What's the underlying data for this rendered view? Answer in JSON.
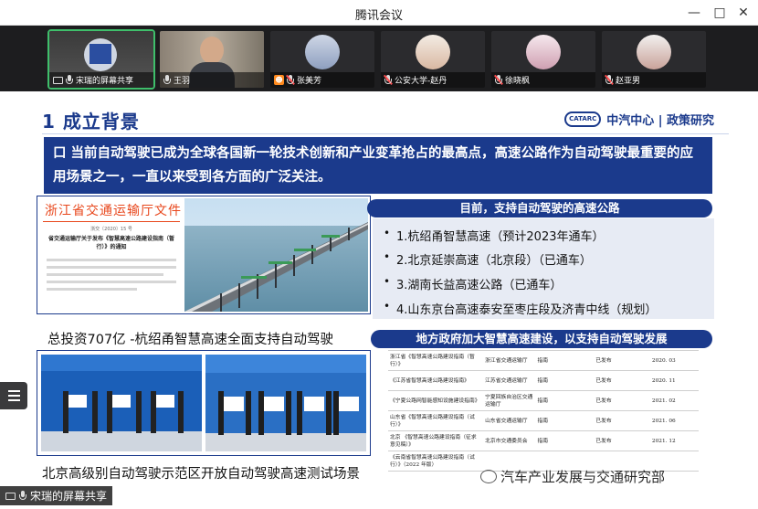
{
  "window": {
    "title": "腾讯会议",
    "controls": [
      "minimize",
      "maximize",
      "close"
    ]
  },
  "participants": [
    {
      "name": "宋瑞的屏幕共享",
      "icon": "screen-share-icon",
      "mic": "on",
      "active": true
    },
    {
      "name": "王羽",
      "icon": "mic-icon",
      "mic": "on",
      "active": false
    },
    {
      "name": "张美芳",
      "icon": "host-icon",
      "mic": "muted",
      "active": false
    },
    {
      "name": "公安大学-赵丹",
      "icon": "mic-muted-icon",
      "mic": "muted",
      "active": false
    },
    {
      "name": "徐晓枫",
      "icon": "mic-muted-icon",
      "mic": "muted",
      "active": false
    },
    {
      "name": "赵亚男",
      "icon": "mic-muted-icon",
      "mic": "muted",
      "active": false
    }
  ],
  "slide": {
    "title": "1  成立背景",
    "logo_mark": "CATARC",
    "logo_brand": "中汽中心 | 政策研究",
    "banner": "口 当前自动驾驶已成为全球各国新一轮技术创新和产业变革抢占的最高点，高速公路作为自动驾驶最重要的应用场景之一，一直以来受到各方面的广泛关注。",
    "doc": {
      "header": "浙江省交通运输厅文件",
      "number": "浙交〔2020〕15 号",
      "subject": "省交通运输厅关于发布《智慧高速公路建设指南（暂行）》的通知"
    },
    "caption_investment": "总投资707亿 -杭绍甬智慧高速全面支持自动驾驶",
    "caption_beijing": "北京高级别自动驾驶示范区开放自动驾驶高速测试场景",
    "highways_title": "目前，支持自动驾驶的高速公路",
    "highways": [
      "1.杭绍甬智慧高速（预计2023年通车）",
      "2.北京延崇高速（北京段）（已通车）",
      "3.湖南长益高速公路（已通车）",
      "4.山东京台高速泰安至枣庄段及济青中线（规划）"
    ],
    "policies_title": "地方政府加大智慧高速建设，以支持自动驾驶发展",
    "policies": [
      {
        "region": "浙江省",
        "doc": "《智慧高速公路建设指南（暂行）》",
        "org": "浙江省交通运输厅",
        "type": "指南",
        "status": "已发布",
        "date": "2020. 03"
      },
      {
        "region": "",
        "doc": "《江苏省智慧高速公路建设指南》",
        "org": "江苏省交通运输厅",
        "type": "指南",
        "status": "已发布",
        "date": "2020. 11"
      },
      {
        "region": "",
        "doc": "《宁夏公路网智能感知设施建设指南》",
        "org": "宁夏回族自治区交通运输厅",
        "type": "指南",
        "status": "已发布",
        "date": "2021. 02"
      },
      {
        "region": "山东省",
        "doc": "《智慧高速公路建设指南（试行）》",
        "org": "山东省交通运输厅",
        "type": "指南",
        "status": "已发布",
        "date": "2021. 06"
      },
      {
        "region": "北京",
        "doc": "《智慧高速公路建设指南（征求意见稿）》",
        "org": "北京市交通委员会",
        "type": "指南",
        "status": "已发布",
        "date": "2021. 12"
      },
      {
        "region": "",
        "doc": "《云南省智慧高速公路建设指南（试行）》（2022 年版）",
        "org": "",
        "type": "",
        "status": "",
        "date": ""
      }
    ]
  },
  "watermark": "汽车产业发展与交通研究部",
  "share_status": "宋瑞的屏幕共享"
}
